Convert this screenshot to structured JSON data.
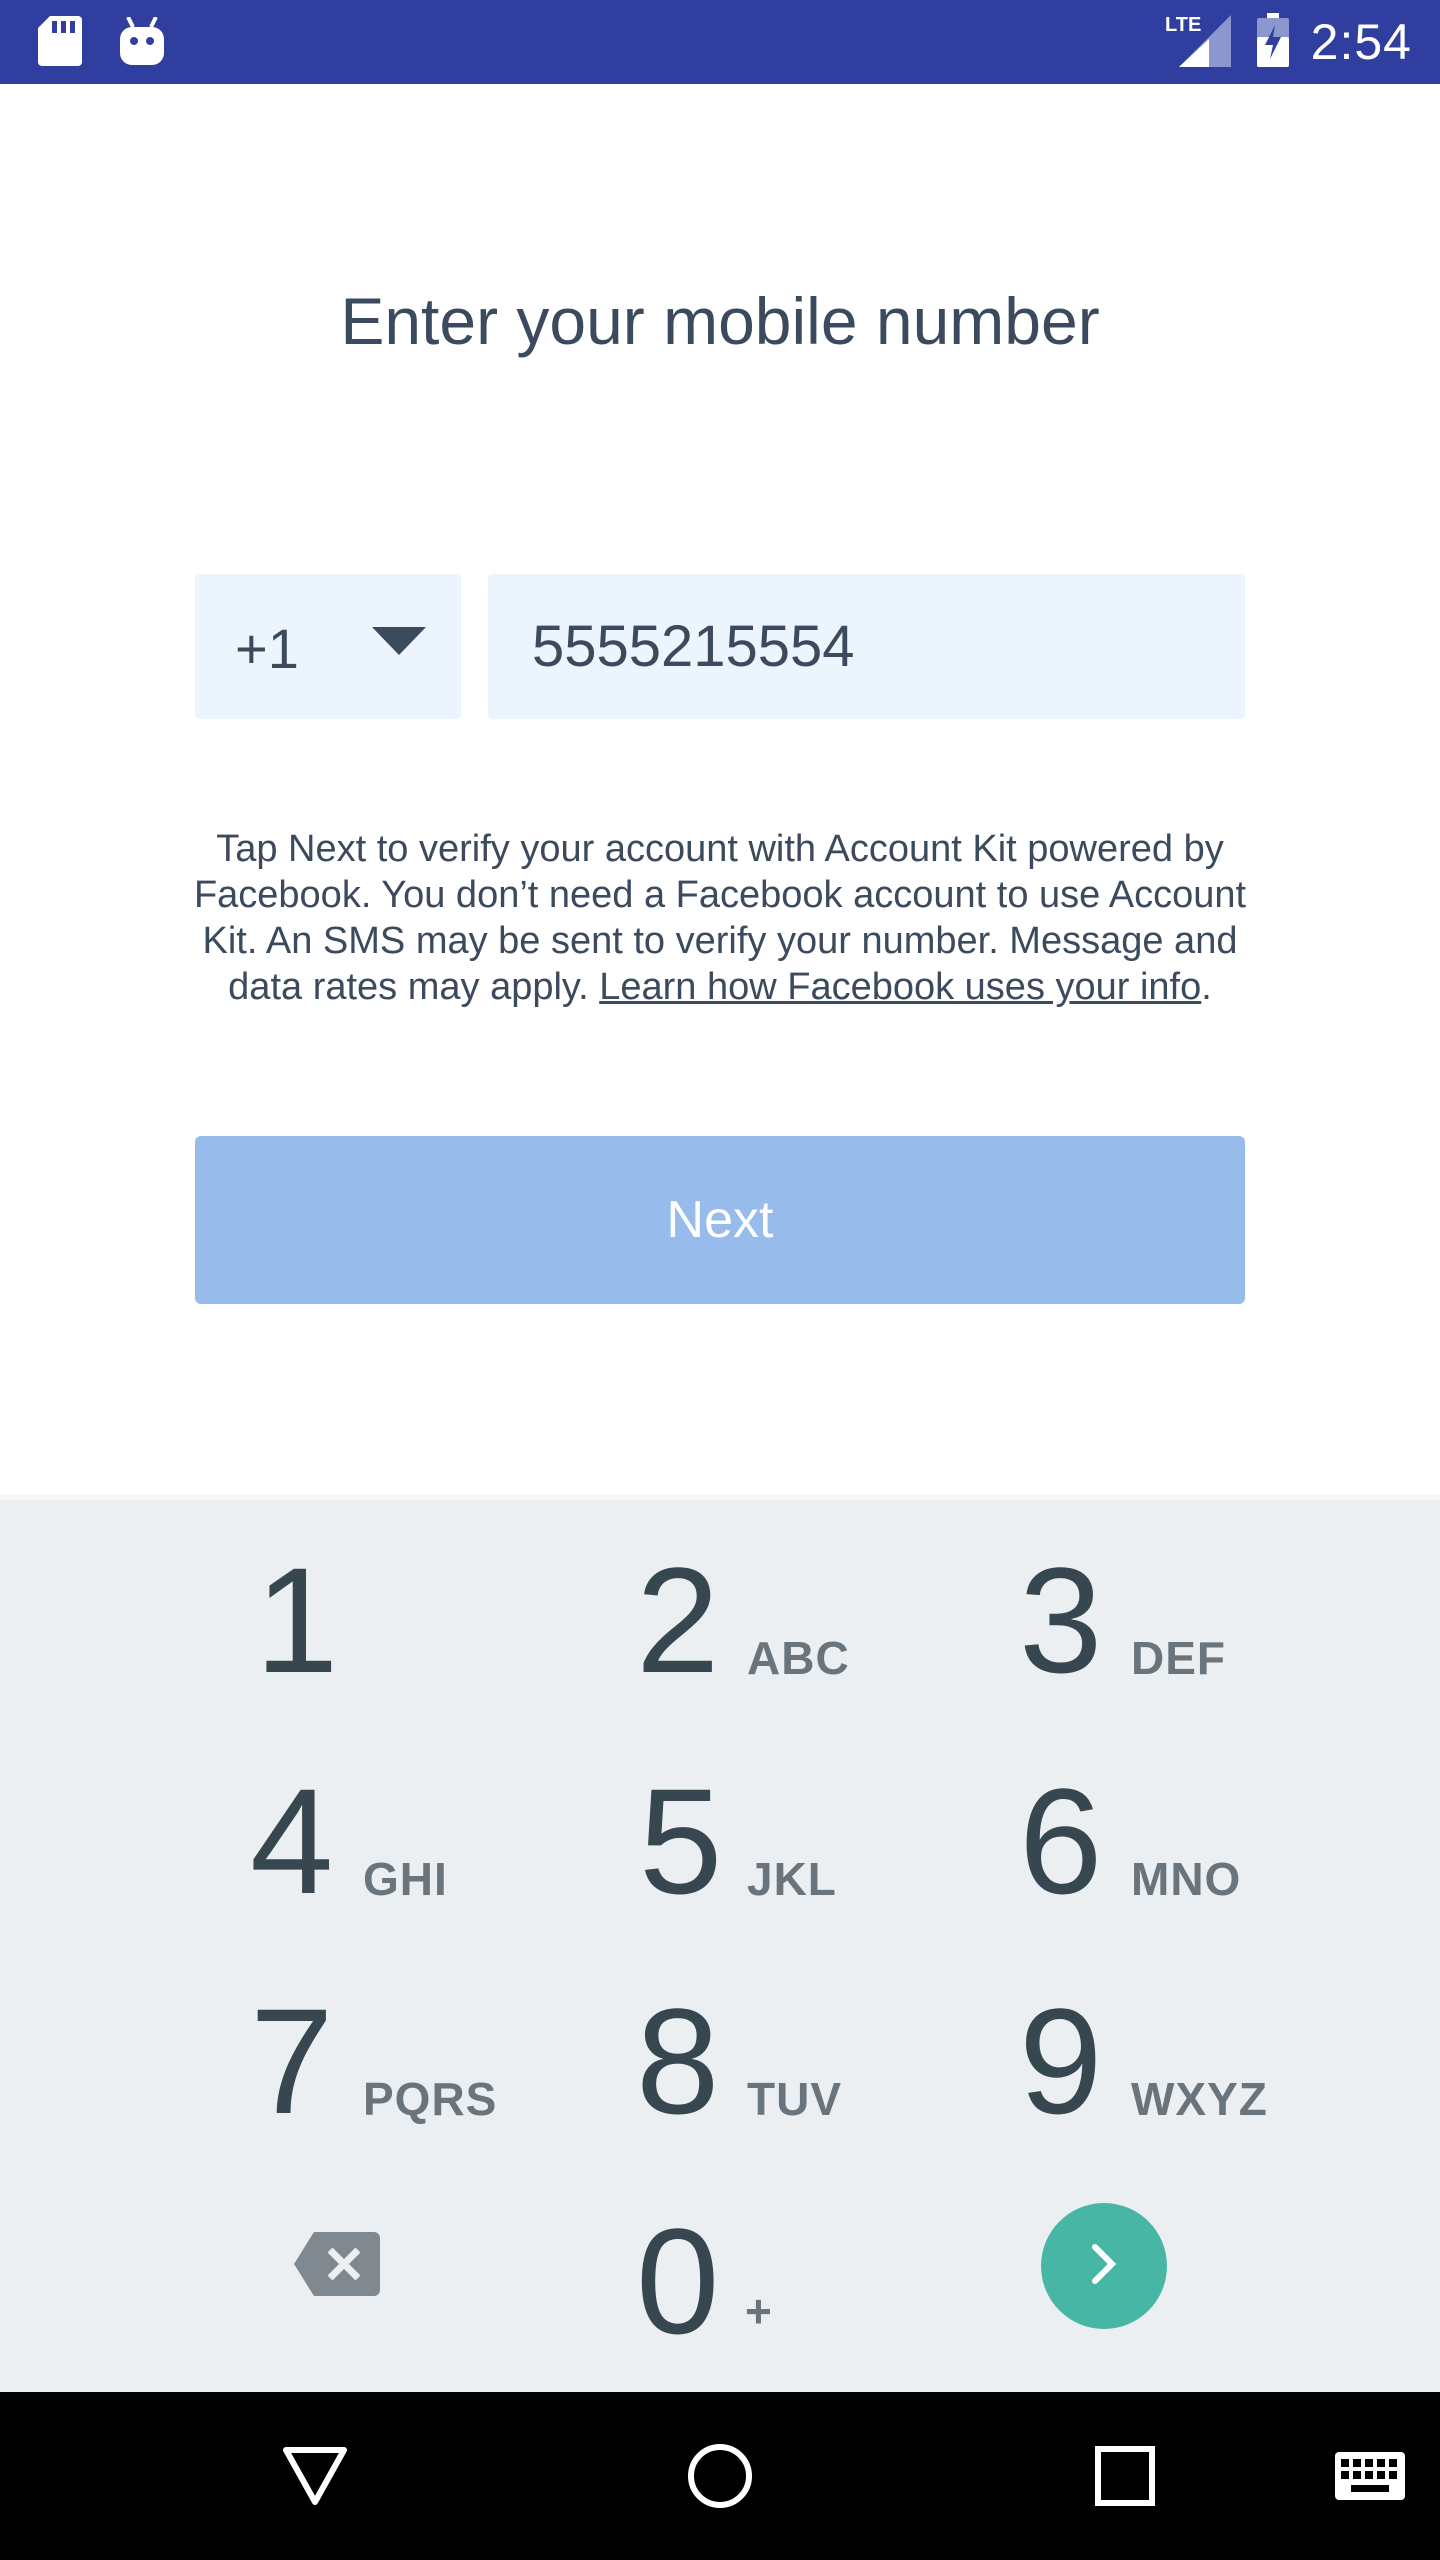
{
  "status_bar": {
    "time": "2:54",
    "network": "LTE",
    "icons": [
      "sd-card-icon",
      "android-icon",
      "signal-icon",
      "battery-charging-icon"
    ]
  },
  "page": {
    "title": "Enter your mobile number"
  },
  "phone_form": {
    "country_code": "+1",
    "phone_number": "5555215554"
  },
  "terms": {
    "text": "Tap Next to verify your account with Account Kit powered by Facebook. You don’t need a Facebook account to use Account Kit. An SMS may be sent to verify your number. Message and data rates may apply. ",
    "link_text": "Learn how Facebook uses your info",
    "trailing": "."
  },
  "actions": {
    "next_label": "Next"
  },
  "keypad": {
    "keys": [
      {
        "digit": "1",
        "letters": ""
      },
      {
        "digit": "2",
        "letters": "ABC"
      },
      {
        "digit": "3",
        "letters": "DEF"
      },
      {
        "digit": "4",
        "letters": "GHI"
      },
      {
        "digit": "5",
        "letters": "JKL"
      },
      {
        "digit": "6",
        "letters": "MNO"
      },
      {
        "digit": "7",
        "letters": "PQRS"
      },
      {
        "digit": "8",
        "letters": "TUV"
      },
      {
        "digit": "9",
        "letters": "WXYZ"
      },
      {
        "digit": "0",
        "letters": "+"
      }
    ],
    "go_color": "#47b6a5"
  },
  "nav_bar": {
    "icons": [
      "back-icon",
      "home-icon",
      "recents-icon",
      "keyboard-icon"
    ]
  },
  "colors": {
    "status_bar": "#303f9f",
    "input_bg": "#ecf4fd",
    "button_disabled": "#97bbeb",
    "text_primary": "#3b4a5c",
    "keypad_bg": "#eceff1"
  }
}
